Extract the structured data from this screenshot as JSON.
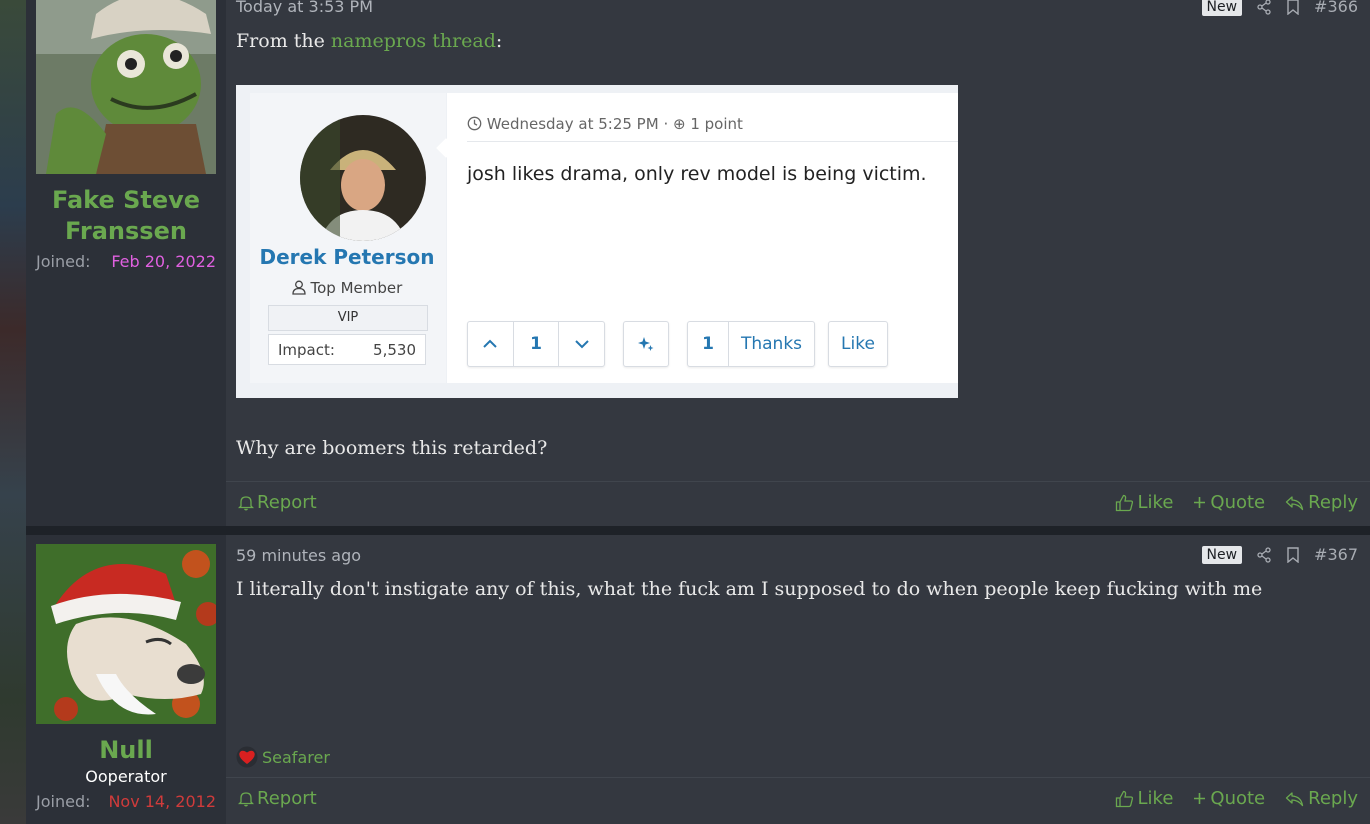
{
  "posts": [
    {
      "author": {
        "name": "Fake Steve Franssen",
        "joined_label": "Joined:",
        "joined_date": "Feb 20, 2022"
      },
      "time": "Today at 3:53 PM",
      "badge": "New",
      "number": "#366",
      "intro_prefix": "From the ",
      "intro_link": "namepros thread",
      "intro_suffix": ":",
      "embed": {
        "meta": "Wednesday at 5:25 PM · ⊕ 1 point",
        "user_name": "Derek Peterson",
        "user_title": "Top Member",
        "vip_label": "VIP",
        "impact_label": "Impact:",
        "impact_value": "5,530",
        "comment": "josh likes drama, only rev model is being victim.",
        "vote_count": "1",
        "thanks_count": "1",
        "thanks_label": "Thanks",
        "like_label": "Like"
      },
      "body_text": "Why are boomers this retarded?",
      "actions": {
        "report": "Report",
        "like": "Like",
        "quote": "Quote",
        "reply": "Reply"
      }
    },
    {
      "author": {
        "name": "Null",
        "title": "Ooperator",
        "joined_label": "Joined:",
        "joined_date": "Nov 14, 2012"
      },
      "time": "59 minutes ago",
      "badge": "New",
      "number": "#367",
      "body_text": "I literally don't instigate any of this, what the fuck am I supposed to do when people keep fucking with me",
      "reaction": "Seafarer",
      "actions": {
        "report": "Report",
        "like": "Like",
        "quote": "Quote",
        "reply": "Reply"
      }
    }
  ],
  "icons": [
    "share-icon",
    "bookmark-icon",
    "bell-icon",
    "thumbs-up-icon",
    "plus-icon",
    "reply-icon",
    "heart-icon",
    "clock-icon",
    "chevron-up-icon",
    "chevron-down-icon",
    "sparkle-icon",
    "user-icon"
  ],
  "colors": {
    "accent": "#6aa84f",
    "joined_a": "#e060e0",
    "joined_b": "#d03b3b",
    "post_bg": "#343840",
    "user_bg": "#2c3038"
  }
}
